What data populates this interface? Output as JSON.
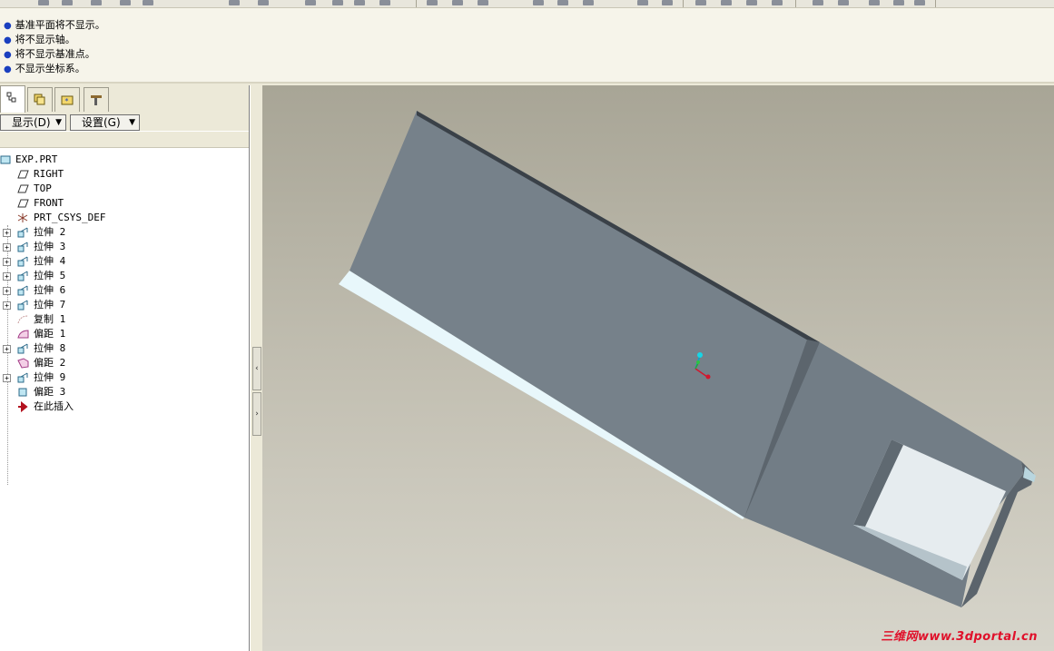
{
  "messages": [
    "基准平面将不显示。",
    "将不显示轴。",
    "将不显示基准点。",
    "不显示坐标系。"
  ],
  "nav_tabs": [
    {
      "name": "model-tree-tab",
      "icon": "tree-icon"
    },
    {
      "name": "layers-tab",
      "icon": "folder-icon"
    },
    {
      "name": "favorites-tab",
      "icon": "star-folder-icon"
    },
    {
      "name": "connections-tab",
      "icon": "tools-icon"
    }
  ],
  "buttons": {
    "show": "显示(D)",
    "settings": "设置(G)"
  },
  "tree": {
    "root": "EXP.PRT",
    "items": [
      {
        "label": "RIGHT",
        "icon": "datum-plane-icon",
        "expandable": false
      },
      {
        "label": "TOP",
        "icon": "datum-plane-icon",
        "expandable": false
      },
      {
        "label": "FRONT",
        "icon": "datum-plane-icon",
        "expandable": false
      },
      {
        "label": "PRT_CSYS_DEF",
        "icon": "csys-icon",
        "expandable": false
      },
      {
        "label": "拉伸 2",
        "icon": "extrude-icon",
        "expandable": true
      },
      {
        "label": "拉伸 3",
        "icon": "extrude-icon",
        "expandable": true
      },
      {
        "label": "拉伸 4",
        "icon": "extrude-icon",
        "expandable": true
      },
      {
        "label": "拉伸 5",
        "icon": "extrude-icon",
        "expandable": true
      },
      {
        "label": "拉伸 6",
        "icon": "extrude-icon",
        "expandable": true
      },
      {
        "label": "拉伸 7",
        "icon": "extrude-icon",
        "expandable": true
      },
      {
        "label": "复制 1",
        "icon": "copy-icon",
        "expandable": false
      },
      {
        "label": "偏距 1",
        "icon": "offset-icon",
        "expandable": false
      },
      {
        "label": "拉伸 8",
        "icon": "extrude-icon",
        "expandable": true
      },
      {
        "label": "偏距 2",
        "icon": "offset-icon",
        "expandable": false
      },
      {
        "label": "拉伸 9",
        "icon": "extrude-icon",
        "expandable": true
      },
      {
        "label": "偏距 3",
        "icon": "offset-solid-icon",
        "expandable": false
      },
      {
        "label": "在此插入",
        "icon": "insert-arrow-icon",
        "expandable": false
      }
    ]
  },
  "watermark": "三维网www.3dportal.cn",
  "colors": {
    "message_bullet": "#1a3fbf",
    "model_face": "#76818a",
    "model_edge_light": "#e8f7fb",
    "background_top": "#a8a596",
    "background_bottom": "#d7d5cb",
    "watermark": "#e0102a"
  }
}
